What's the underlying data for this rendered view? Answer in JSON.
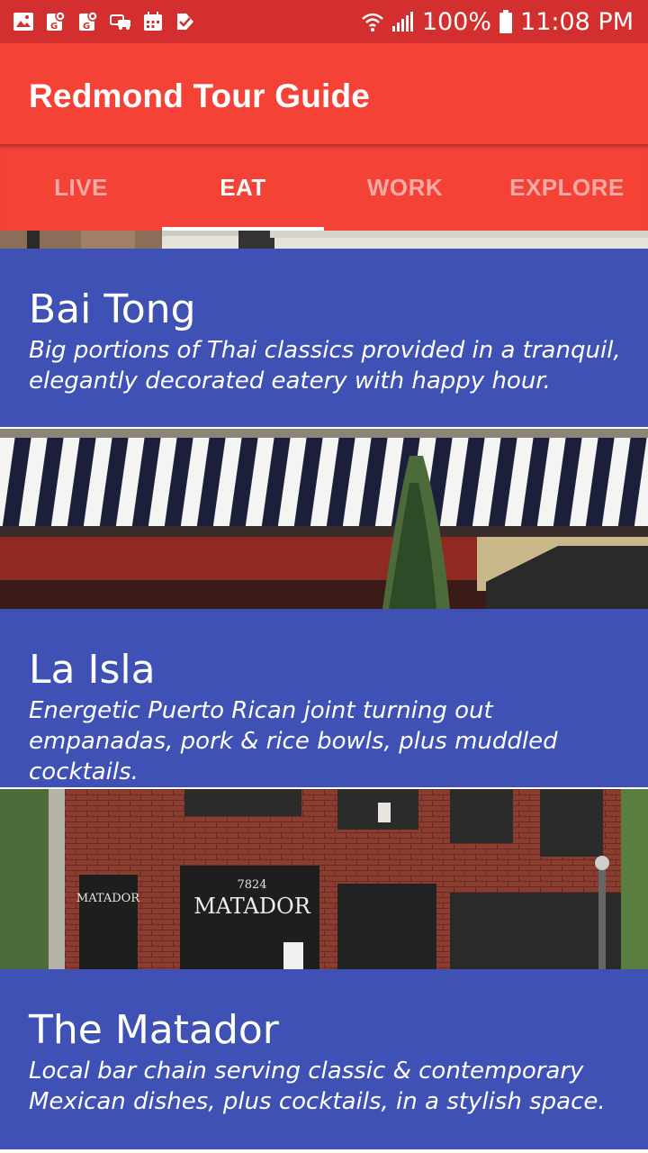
{
  "status_bar": {
    "battery": "100%",
    "time": "11:08 PM",
    "icons": [
      "gallery-icon",
      "maps-notification-icon",
      "maps-notification-icon",
      "car-icon",
      "calendar-icon",
      "tasks-icon",
      "wifi-icon",
      "signal-icon",
      "battery-icon"
    ]
  },
  "app": {
    "title": "Redmond Tour Guide"
  },
  "tabs": [
    {
      "label": "LIVE",
      "active": false
    },
    {
      "label": "EAT",
      "active": true
    },
    {
      "label": "WORK",
      "active": false
    },
    {
      "label": "EXPLORE",
      "active": false
    }
  ],
  "places": [
    {
      "name": "Bai Tong",
      "description": "Big portions of Thai classics provided in a tranquil, elegantly decorated eatery with happy hour."
    },
    {
      "name": "La Isla",
      "description": "Energetic Puerto Rican joint turning out empanadas, pork & rice bowls, plus muddled cocktails."
    },
    {
      "name": "The Matador",
      "description": "Local bar chain serving classic & contemporary Mexican dishes, plus cocktails, in a stylish space."
    }
  ],
  "photo_signs": {
    "matador_main": "MATADOR",
    "matador_left": "MATADOR",
    "matador_number": "7824"
  },
  "colors": {
    "status_bar": "#d32f2f",
    "app_bar": "#f44336",
    "card": "#3f51b5"
  }
}
